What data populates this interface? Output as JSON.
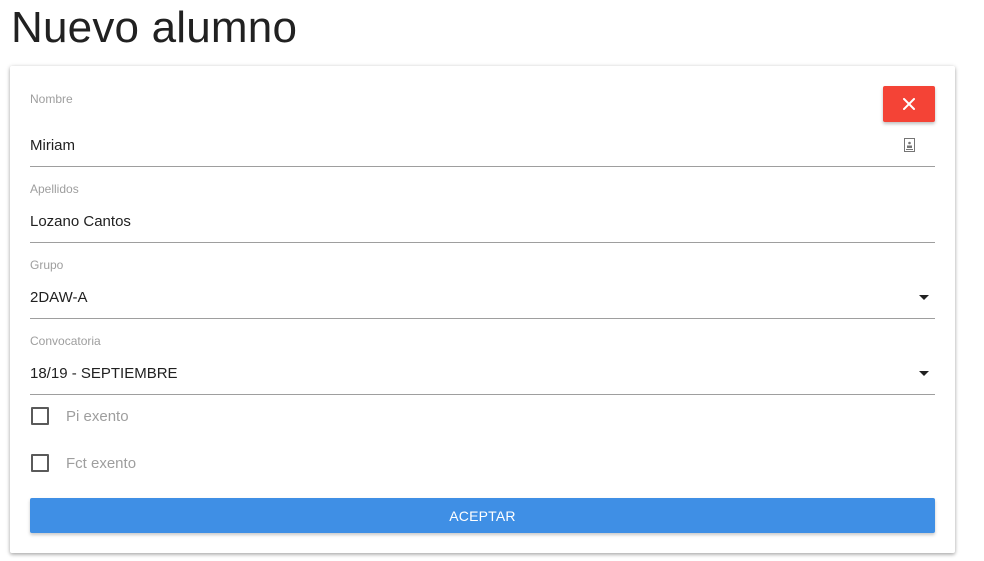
{
  "page": {
    "title": "Nuevo alumno"
  },
  "form": {
    "close_icon": "close-icon",
    "nombre": {
      "label": "Nombre",
      "value": "Miriam",
      "icon": "contact-card-icon"
    },
    "apellidos": {
      "label": "Apellidos",
      "value": "Lozano Cantos"
    },
    "grupo": {
      "label": "Grupo",
      "value": "2DAW-A",
      "icon": "dropdown-arrow-icon"
    },
    "convocatoria": {
      "label": "Convocatoria",
      "value": "18/19 - SEPTIEMBRE",
      "icon": "dropdown-arrow-icon"
    },
    "checkboxes": [
      {
        "label": "Pi exento",
        "checked": false
      },
      {
        "label": "Fct exento",
        "checked": false
      }
    ],
    "accept_label": "ACEPTAR"
  },
  "colors": {
    "close_button": "#f44336",
    "accept_button": "#3f8fe5",
    "label_gray": "#9e9e9e",
    "text": "#212121"
  }
}
